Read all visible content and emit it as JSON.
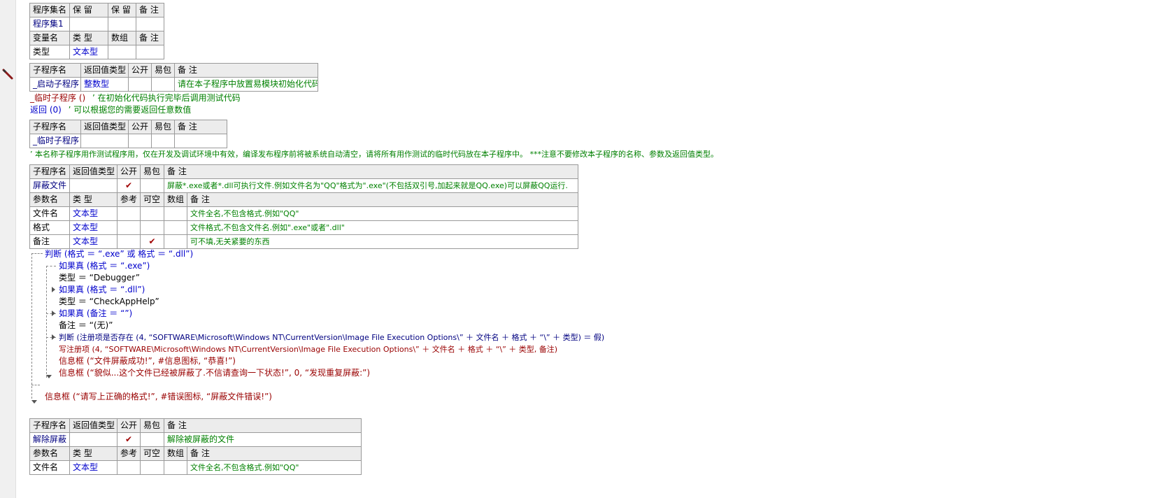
{
  "assembly_table": {
    "header1": [
      "程序集名",
      "保 留",
      "保 留",
      "备 注"
    ],
    "row1": [
      "程序集1",
      "",
      "",
      ""
    ],
    "header2": [
      "变量名",
      "类 型",
      "数组",
      "备 注"
    ],
    "row2": [
      "类型",
      "文本型",
      "",
      ""
    ]
  },
  "sub1": {
    "header": [
      "子程序名",
      "返回值类型",
      "公开",
      "易包",
      "备 注"
    ],
    "name": "_启动子程序",
    "return_type": "整数型",
    "note": "请在本子程序中放置易模块初始化代码"
  },
  "sub1_body": {
    "line1_call": "_临时子程序 ()",
    "line1_comment": "’ 在初始化代码执行完毕后调用测试代码",
    "line2_call": "返回 (0)",
    "line2_comment": "’ 可以根据您的需要返回任意数值"
  },
  "sub2": {
    "header": [
      "子程序名",
      "返回值类型",
      "公开",
      "易包",
      "备 注"
    ],
    "name": "_临时子程序"
  },
  "sub2_comment": "’ 本名称子程序用作测试程序用，仅在开发及调试环境中有效，编译发布程序前将被系统自动清空，请将所有用作测试的临时代码放在本子程序中。 ***注意不要修改本子程序的名称、参数及返回值类型。",
  "sub3": {
    "header": [
      "子程序名",
      "返回值类型",
      "公开",
      "易包",
      "备 注"
    ],
    "name": "屏蔽文件",
    "public_check": "✔",
    "note": "屏蔽*.exe或者*.dll可执行文件.例如文件名为\"QQ\"格式为\".exe\"(不包括双引号,加起来就是QQ.exe)可以屏蔽QQ运行.",
    "param_header": [
      "参数名",
      "类 型",
      "参考",
      "可空",
      "数组",
      "备 注"
    ],
    "params": [
      {
        "name": "文件名",
        "type": "文本型",
        "nullable": "",
        "note": "文件全名,不包含格式.例如\"QQ\""
      },
      {
        "name": "格式",
        "type": "文本型",
        "nullable": "",
        "note": "文件格式,不包含文件名.例如\".exe\"或者\".dll\""
      },
      {
        "name": "备注",
        "type": "文本型",
        "nullable": "✔",
        "note": "可不填,无关紧要的东西"
      }
    ]
  },
  "code": {
    "l1": "判断 (格式 ＝ “.exe” 或 格式 ＝ “.dll”)",
    "l2": "如果真 (格式 ＝ “.exe”)",
    "l3": "类型 ＝ “Debugger”",
    "l4": "如果真 (格式 ＝ “.dll”)",
    "l5": "类型 ＝ “CheckAppHelp”",
    "l6": "如果真 (备注 ＝ “”)",
    "l7": "备注 ＝ “(无)”",
    "l8": "判断 (注册项是否存在 (4, “SOFTWARE\\Microsoft\\Windows NT\\CurrentVersion\\Image File Execution Options\\” ＋ 文件名 ＋ 格式 ＋ “\\” ＋ 类型) ＝ 假)",
    "l9": "写注册项 (4, “SOFTWARE\\Microsoft\\Windows NT\\CurrentVersion\\Image File Execution Options\\” ＋ 文件名 ＋ 格式 ＋ “\\” ＋ 类型, 备注)",
    "l10": "信息框 (“文件屏蔽成功!”, #信息图标, “恭喜!”)",
    "l11": "信息框 (“貌似...这个文件已经被屏蔽了.不信请查询一下状态!”, 0, “发现重复屏蔽:”)",
    "l12": "信息框 (“请写上正确的格式!”, #错误图标, “屏蔽文件错误!”)"
  },
  "sub4": {
    "header": [
      "子程序名",
      "返回值类型",
      "公开",
      "易包",
      "备 注"
    ],
    "name": "解除屏蔽",
    "public_check": "✔",
    "note": "解除被屏蔽的文件",
    "param_header": [
      "参数名",
      "类 型",
      "参考",
      "可空",
      "数组",
      "备 注"
    ],
    "param1_name": "文件名",
    "param1_type": "文本型",
    "param1_note": "文件全名,不包含格式.例如\"QQ\""
  },
  "colors": {
    "keyword_blue": "#0000cc",
    "comment_green": "#008000",
    "call_red": "#8b0000",
    "string_teal": "#007070",
    "header_bg": "#ececec"
  },
  "icons": {
    "gutter_marker": "pencil-icon"
  }
}
